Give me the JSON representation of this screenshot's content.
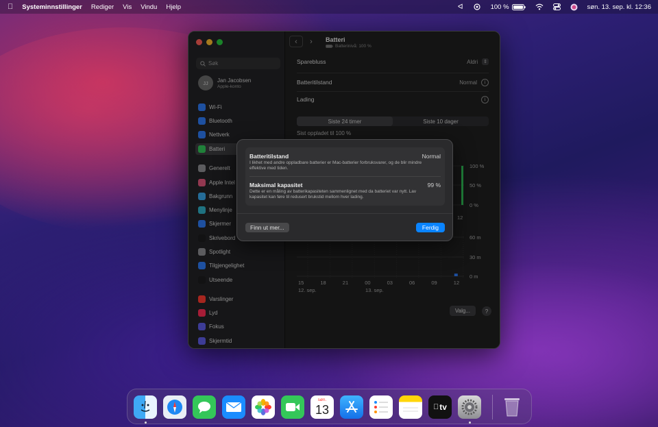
{
  "menubar": {
    "app": "Systeminnstillinger",
    "menus": [
      "Rediger",
      "Vis",
      "Vindu",
      "Hjelp"
    ],
    "battery": "100 %",
    "datetime": "søn. 13. sep. kl. 12:36"
  },
  "sidebar": {
    "search_placeholder": "Søk",
    "user": {
      "initials": "JJ",
      "name": "Jan Jacobsen",
      "sub": "Apple-konto"
    },
    "items": [
      {
        "label": "Wi-Fi",
        "color": "#2f7cf6"
      },
      {
        "label": "Bluetooth",
        "color": "#2f7cf6"
      },
      {
        "label": "Nettverk",
        "color": "#2f7cf6"
      },
      {
        "label": "Batteri",
        "color": "#32c759"
      },
      {
        "label": "Generelt",
        "color": "#8e8e93"
      },
      {
        "label": "Apple Intel",
        "color": "#e0567b"
      },
      {
        "label": "Bakgrunn",
        "color": "#39a7ea"
      },
      {
        "label": "Menylinje",
        "color": "#30b0c7"
      },
      {
        "label": "Skjermer",
        "color": "#2f7cf6"
      },
      {
        "label": "Skrivebord",
        "color": "#1c1c1e"
      },
      {
        "label": "Spotlight",
        "color": "#8e8e93"
      },
      {
        "label": "Tilgjengelighet",
        "color": "#2f7cf6"
      },
      {
        "label": "Utseende",
        "color": "#1c1c1e"
      },
      {
        "label": "Varslinger",
        "color": "#ff3b30"
      },
      {
        "label": "Lyd",
        "color": "#ff2d55"
      },
      {
        "label": "Fokus",
        "color": "#5e5ce6"
      },
      {
        "label": "Skjermtid",
        "color": "#5e5ce6"
      }
    ]
  },
  "content": {
    "title": "Batteri",
    "subtitle": "Batterinivå: 100 %",
    "rows": [
      {
        "label": "Sparebluss",
        "value": "Aldri"
      },
      {
        "label": "Batteritilstand",
        "value": "Normal"
      },
      {
        "label": "Lading",
        "value": ""
      }
    ],
    "tabs": [
      "Siste 24 timer",
      "Siste 10 dager"
    ],
    "last_charged": "Sist oppladet til 100 %",
    "options_button": "Valg...",
    "help_button": "?"
  },
  "chart_data": [
    {
      "type": "bar",
      "title": "",
      "y_ticks": [
        "100 %",
        "50 %",
        "0 %"
      ],
      "ylim": [
        0,
        100
      ],
      "x_ticks_partial": [
        "12"
      ]
    },
    {
      "type": "bar",
      "title": "",
      "y_ticks": [
        "60 m",
        "30 m",
        "0 m"
      ],
      "ylim": [
        0,
        60
      ],
      "categories": [
        "15",
        "18",
        "21",
        "00",
        "03",
        "06",
        "09",
        "12"
      ],
      "date_labels": [
        "12. sep.",
        "13. sep."
      ],
      "values": [
        0,
        0,
        0,
        0,
        0,
        0,
        0,
        4
      ],
      "bar_color": "#2f7cf6"
    }
  ],
  "sheet": {
    "item1": {
      "title": "Batteritilstand",
      "value": "Normal",
      "desc": "I likhet med andre oppladbare batterier er Mac-batterier forbruksvarer, og de blir mindre effektive med tiden."
    },
    "item2": {
      "title": "Maksimal kapasitet",
      "value": "99 %",
      "desc": "Dette er en måling av batterikapasiteten sammenlignet med da batteriet var nytt. Lav kapasitet kan føre til redusert brukstid mellom hver lading."
    },
    "learn_more": "Finn ut mer...",
    "done": "Ferdig"
  },
  "dock": {
    "calendar_month": "søn.",
    "calendar_day": "13",
    "tv_label": "tv",
    "apps": [
      "Finder",
      "Safari",
      "Meldinger",
      "Mail",
      "Bilder",
      "FaceTime",
      "Kalender",
      "App Store",
      "Påminnelser",
      "Notater",
      "Apple TV",
      "Systeminnstillinger",
      "Papirkurv"
    ]
  }
}
